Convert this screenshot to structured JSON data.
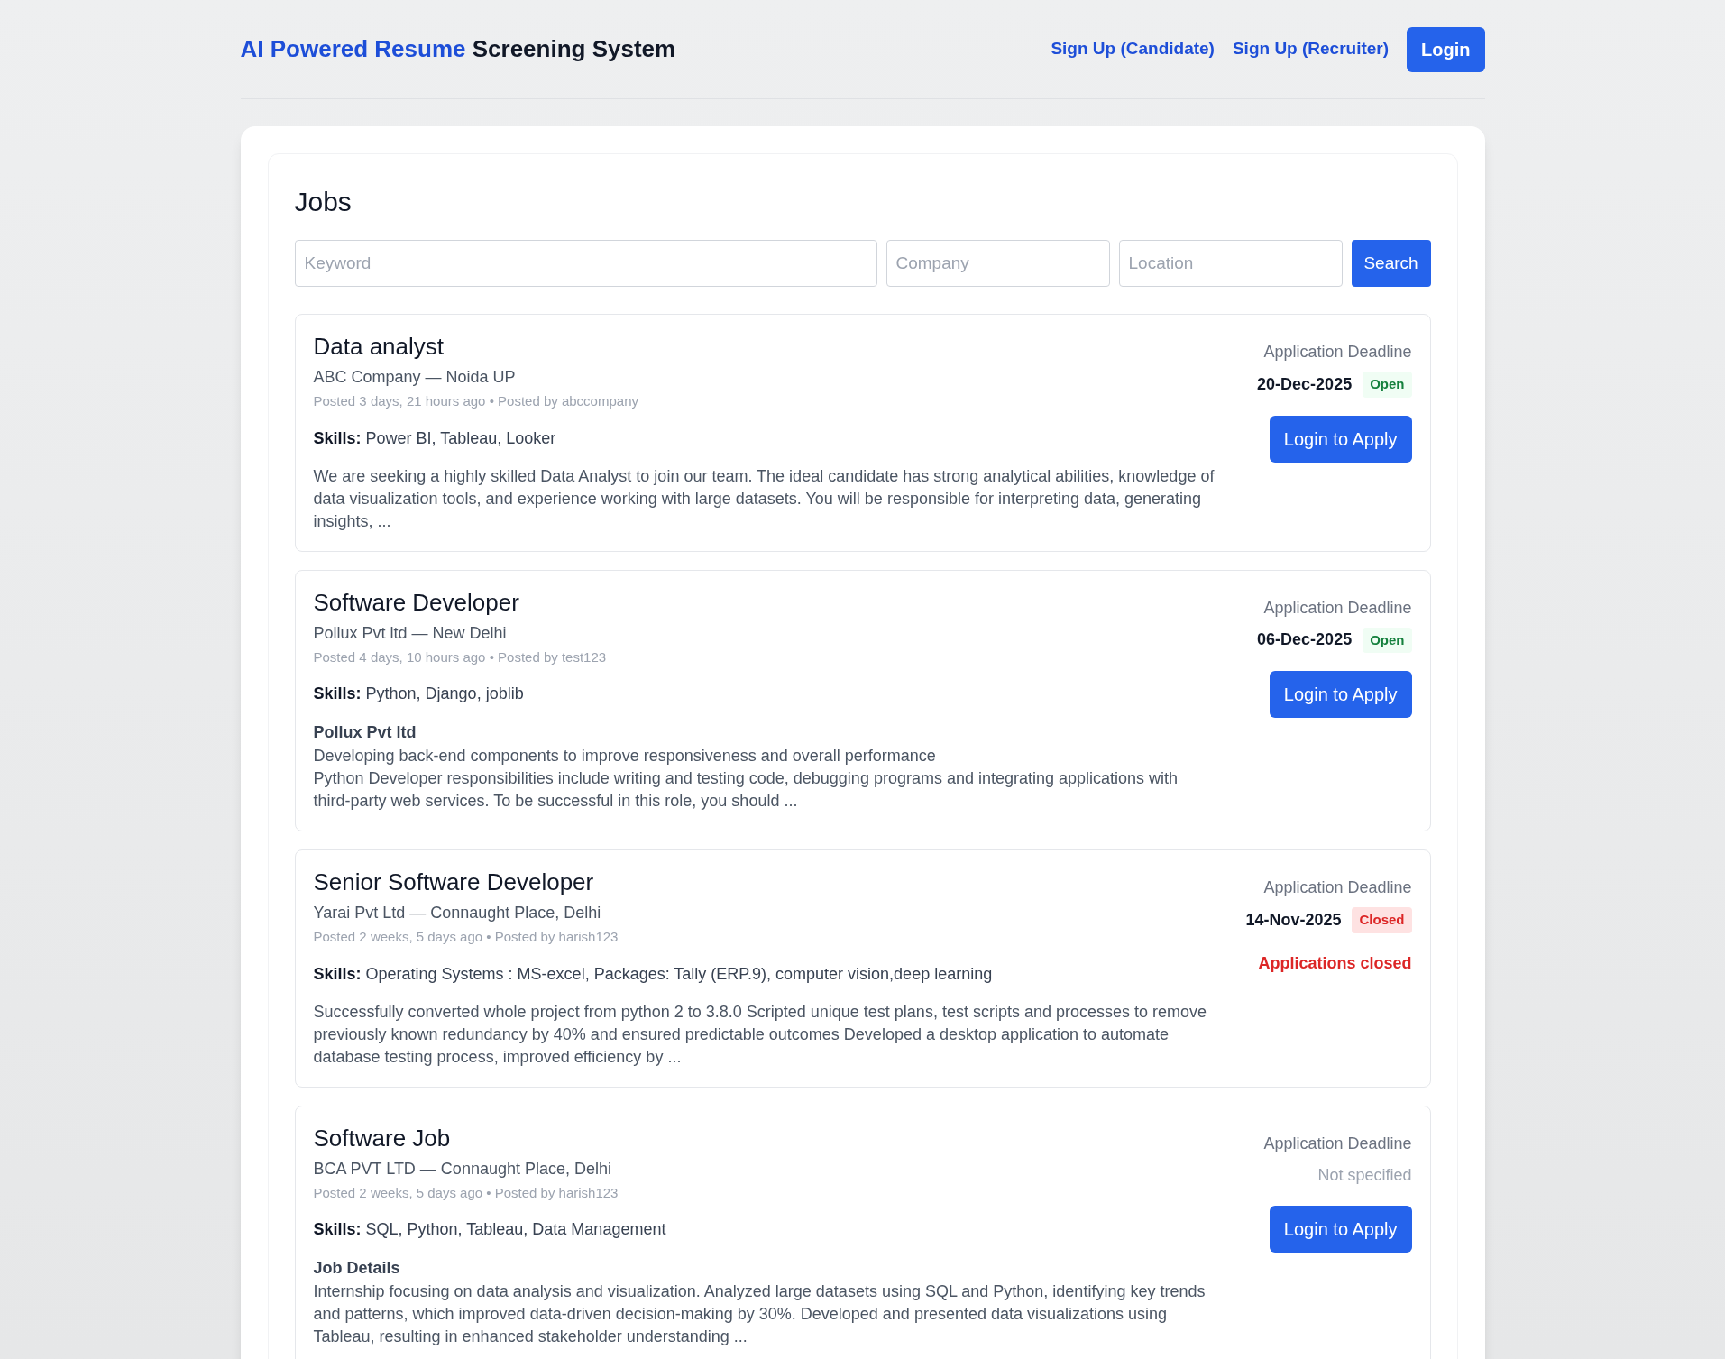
{
  "header": {
    "brand_highlight": "AI Powered Resume",
    "brand_rest": "Screening System",
    "links": [
      "Sign Up (Candidate)",
      "Sign Up (Recruiter)"
    ],
    "login_button": "Login"
  },
  "page_title": "Jobs",
  "search": {
    "fields": [
      {
        "placeholder": "Keyword"
      },
      {
        "placeholder": "Company"
      },
      {
        "placeholder": "Location"
      }
    ],
    "button": "Search"
  },
  "jobs": [
    {
      "title": "Data analyst",
      "company_location": "ABC Company — Noida UP",
      "meta": "Posted 3 days, 21 hours ago • Posted by abccompany",
      "skills_label": "Skills:",
      "skills": "Power BI, Tableau, Looker",
      "description_lines": [
        "We are seeking a highly skilled Data Analyst to join our team. The ideal candidate has strong analytical abilities, knowledge of data visualization tools, and experience working with large datasets. You will be responsible for interpreting data, generating insights, ..."
      ],
      "deadline_label": "Application Deadline",
      "deadline": "20-Dec-2025",
      "status": {
        "kind": "open",
        "label": "Open"
      },
      "action": {
        "kind": "button",
        "label": "Login to Apply"
      }
    },
    {
      "title": "Software Developer",
      "company_location": "Pollux Pvt ltd — New Delhi",
      "meta": "Posted 4 days, 10 hours ago • Posted by test123",
      "skills_label": "Skills:",
      "skills": "Python, Django, joblib",
      "description_heading": "Pollux Pvt ltd",
      "description_lines": [
        "Developing back-end components to improve responsiveness and overall performance",
        "Python Developer responsibilities include writing and testing code, debugging programs and integrating applications with third-party web services. To be successful in this role, you should ..."
      ],
      "deadline_label": "Application Deadline",
      "deadline": "06-Dec-2025",
      "status": {
        "kind": "open",
        "label": "Open"
      },
      "action": {
        "kind": "button",
        "label": "Login to Apply"
      }
    },
    {
      "title": "Senior Software Developer",
      "company_location": "Yarai Pvt Ltd — Connaught Place, Delhi",
      "meta": "Posted 2 weeks, 5 days ago • Posted by harish123",
      "skills_label": "Skills:",
      "skills": "Operating Systems : MS-excel, Packages: Tally (ERP.9), computer vision,deep learning",
      "description_lines": [
        "Successfully converted whole project from python 2 to 3.8.0 Scripted unique test plans, test scripts and processes to remove previously known redundancy by 40% and ensured predictable outcomes Developed a desktop application to automate database testing process, improved efficiency by ..."
      ],
      "deadline_label": "Application Deadline",
      "deadline": "14-Nov-2025",
      "status": {
        "kind": "closed",
        "label": "Closed"
      },
      "action": {
        "kind": "note",
        "label": "Applications closed"
      }
    },
    {
      "title": "Software Job",
      "company_location": "BCA PVT LTD — Connaught Place, Delhi",
      "meta": "Posted 2 weeks, 5 days ago • Posted by harish123",
      "skills_label": "Skills:",
      "skills": "SQL, Python, Tableau, Data Management",
      "description_heading": "Job Details",
      "description_lines": [
        "Internship focusing on data analysis and visualization. Analyzed large datasets using SQL and Python, identifying key trends and patterns, which improved data-driven decision-making by 30%. Developed and presented data visualizations using Tableau, resulting in enhanced stakeholder understanding ..."
      ],
      "deadline_label": "Application Deadline",
      "deadline_missing": "Not specified",
      "action": {
        "kind": "button",
        "label": "Login to Apply"
      }
    }
  ]
}
